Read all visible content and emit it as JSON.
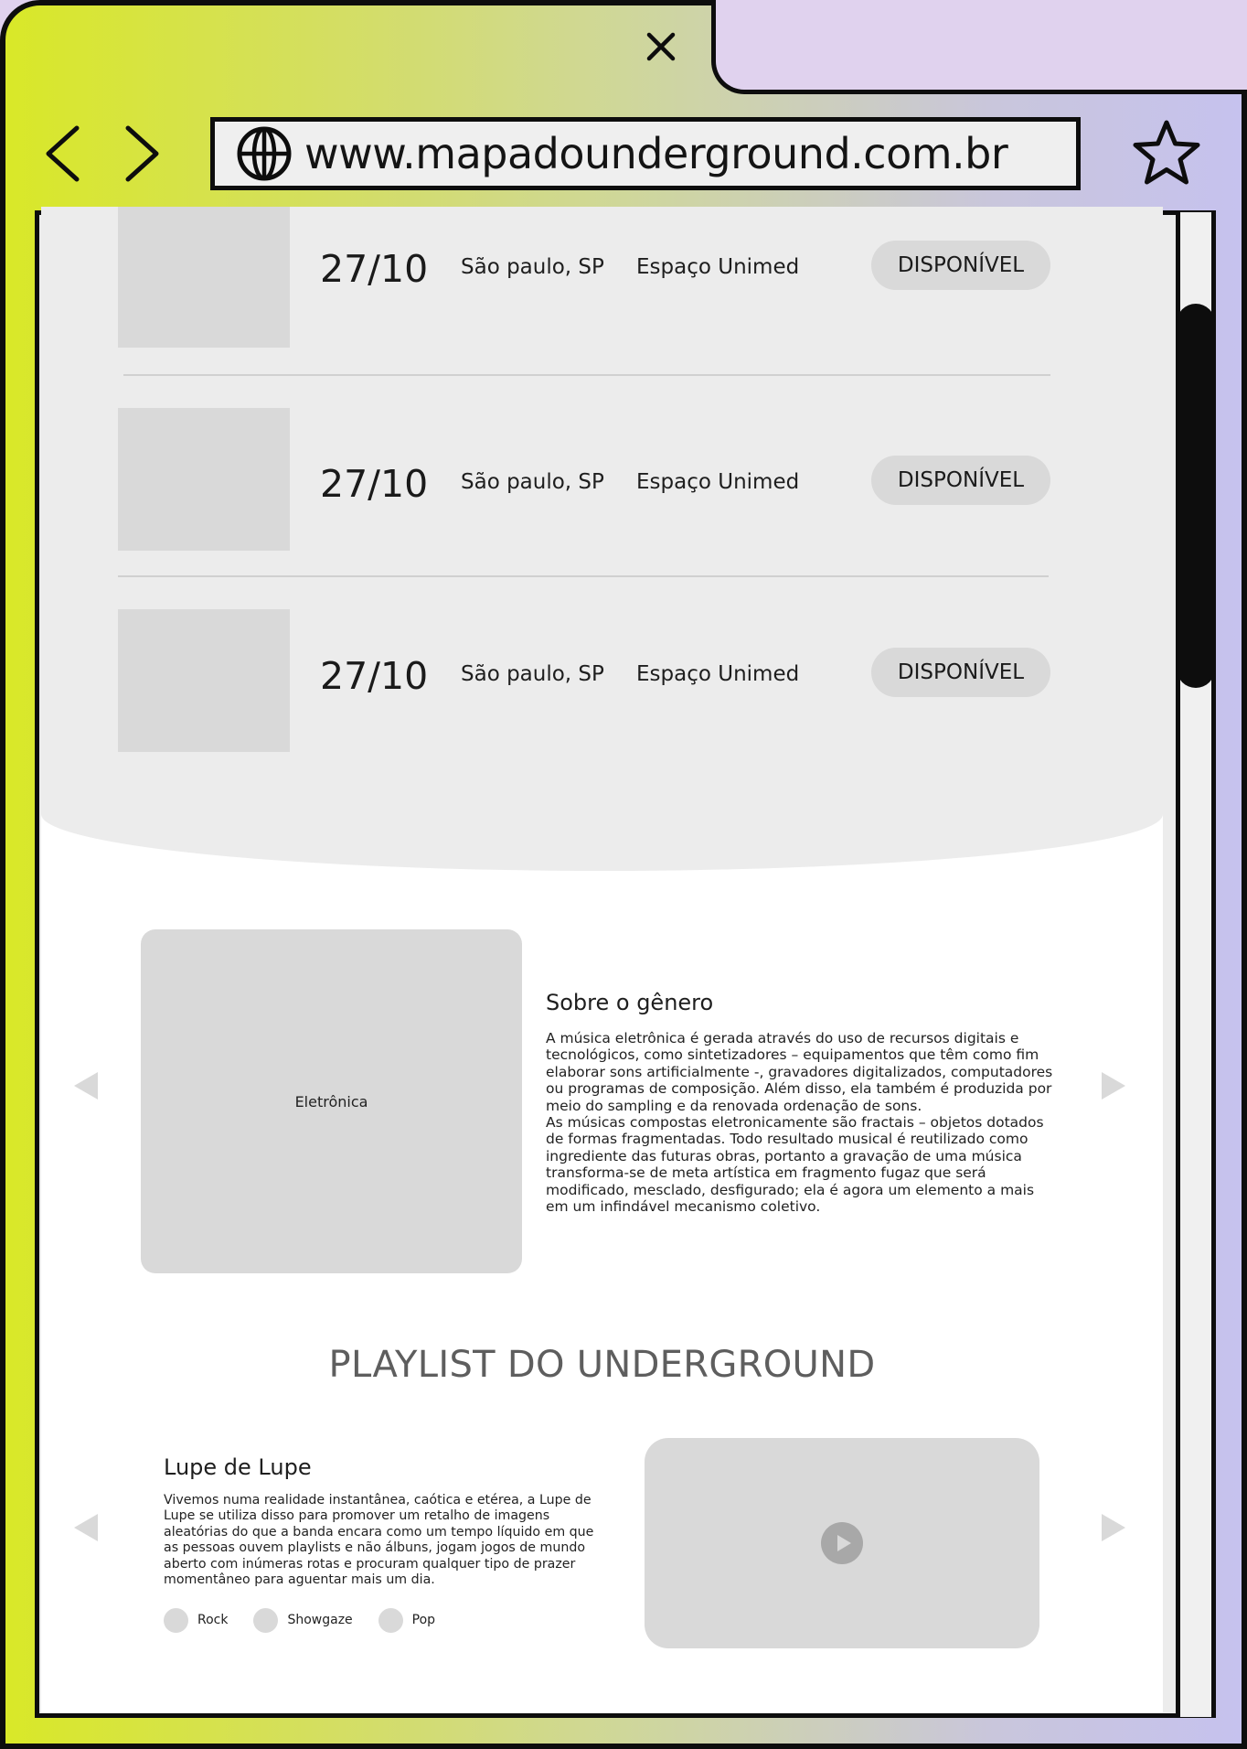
{
  "browser": {
    "url": "www.mapadounderground.com.br"
  },
  "events": [
    {
      "date": "27/10",
      "city": "São paulo, SP",
      "venue": "Espaço Unimed",
      "status": "DISPONÍVEL"
    },
    {
      "date": "27/10",
      "city": "São paulo, SP",
      "venue": "Espaço Unimed",
      "status": "DISPONÍVEL"
    },
    {
      "date": "27/10",
      "city": "São paulo, SP",
      "venue": "Espaço Unimed",
      "status": "DISPONÍVEL"
    }
  ],
  "genre": {
    "name": "Eletrônica",
    "title": "Sobre o gênero",
    "paragraphs": [
      "A música eletrônica é gerada através do uso de recursos digitais e tecnológicos, como sintetizadores – equipamentos que têm como fim elaborar sons artificialmente -, gravadores digitalizados, computadores ou programas de composição. Além disso, ela também é produzida por meio do sampling e da renovada ordenação de sons.",
      "As músicas compostas eletronicamente são fractais – objetos dotados de formas fragmentadas. Todo resultado musical é reutilizado como ingrediente das futuras obras, portanto a gravação de uma música transforma-se de meta artística em fragmento fugaz que será modificado, mesclado, desfigurado; ela é agora um elemento a mais em um infindável mecanismo coletivo."
    ]
  },
  "playlist": {
    "heading": "PLAYLIST DO UNDERGROUND",
    "band": "Lupe de Lupe",
    "description": "Vivemos numa realidade instantânea, caótica e etérea, a Lupe de Lupe se utiliza disso para promover um retalho de imagens aleatórias do que a banda encara como um tempo líquido em que as pessoas ouvem playlists e não álbuns, jogam jogos de mundo aberto com inúmeras rotas e procuram qualquer tipo de prazer momentâneo para aguentar mais um dia.",
    "tags": [
      "Rock",
      "Showgaze",
      "Pop"
    ]
  }
}
